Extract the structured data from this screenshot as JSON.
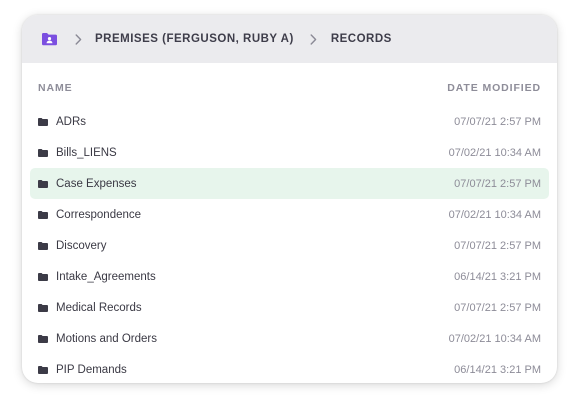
{
  "breadcrumb": {
    "items": [
      "PREMISES (FERGUSON, RUBY A)",
      "RECORDS"
    ]
  },
  "columns": {
    "name": "NAME",
    "date_modified": "DATE MODIFIED"
  },
  "files": [
    {
      "name": "ADRs",
      "date": "07/07/21 2:57 PM",
      "selected": false
    },
    {
      "name": "Bills_LIENS",
      "date": "07/02/21 10:34 AM",
      "selected": false
    },
    {
      "name": "Case Expenses",
      "date": "07/07/21 2:57 PM",
      "selected": true
    },
    {
      "name": "Correspondence",
      "date": "07/02/21 10:34 AM",
      "selected": false
    },
    {
      "name": "Discovery",
      "date": "07/07/21 2:57 PM",
      "selected": false
    },
    {
      "name": "Intake_Agreements",
      "date": "06/14/21 3:21 PM",
      "selected": false
    },
    {
      "name": "Medical Records",
      "date": "07/07/21 2:57 PM",
      "selected": false
    },
    {
      "name": "Motions and Orders",
      "date": "07/02/21 10:34 AM",
      "selected": false
    },
    {
      "name": "PIP Demands",
      "date": "06/14/21 3:21 PM",
      "selected": false
    }
  ],
  "colors": {
    "accent": "#7b4fe0",
    "header_bg": "#ebebee",
    "selected_row": "#e7f5ec",
    "folder_icon": "#3c3b47"
  },
  "icons": {
    "root": "folder-person-icon",
    "separator": "chevron-right-icon",
    "row": "folder-icon"
  }
}
